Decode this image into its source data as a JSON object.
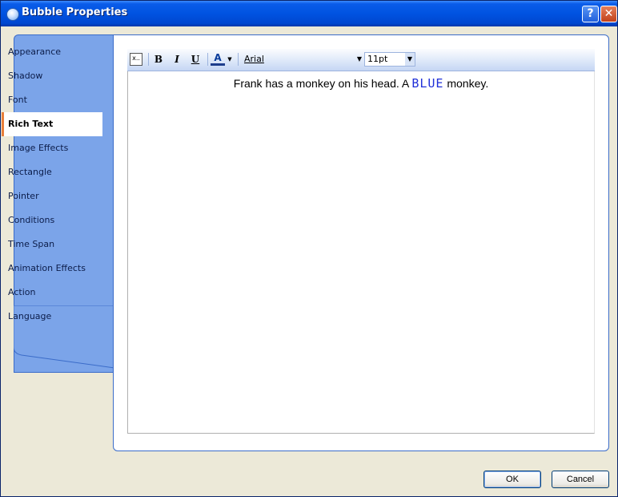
{
  "window": {
    "title": "Bubble Properties",
    "help_glyph": "?",
    "close_glyph": "✕"
  },
  "sidebar": {
    "items": [
      {
        "label": "Appearance"
      },
      {
        "label": "Shadow"
      },
      {
        "label": "Font"
      },
      {
        "label": "Rich Text",
        "selected": true
      },
      {
        "label": "Image Effects"
      },
      {
        "label": "Rectangle"
      },
      {
        "label": "Pointer"
      },
      {
        "label": "Conditions"
      },
      {
        "label": "Time Span"
      },
      {
        "label": "Animation Effects"
      },
      {
        "label": "Action"
      },
      {
        "label": "Language"
      }
    ]
  },
  "toolbar": {
    "bold": "B",
    "italic": "I",
    "underline": "U",
    "font_color": "A",
    "font_name": "Arial",
    "font_size": "11pt",
    "icons": [
      "clear-format-icon",
      "bold-icon",
      "italic-icon",
      "underline-icon",
      "font-color-icon"
    ]
  },
  "editor": {
    "text_before": "Frank has a monkey on his head. A ",
    "blue_word": "BLUE",
    "text_after": " monkey.",
    "blue_color": "#1F2FD8"
  },
  "buttons": {
    "ok": "OK",
    "cancel": "Cancel"
  }
}
